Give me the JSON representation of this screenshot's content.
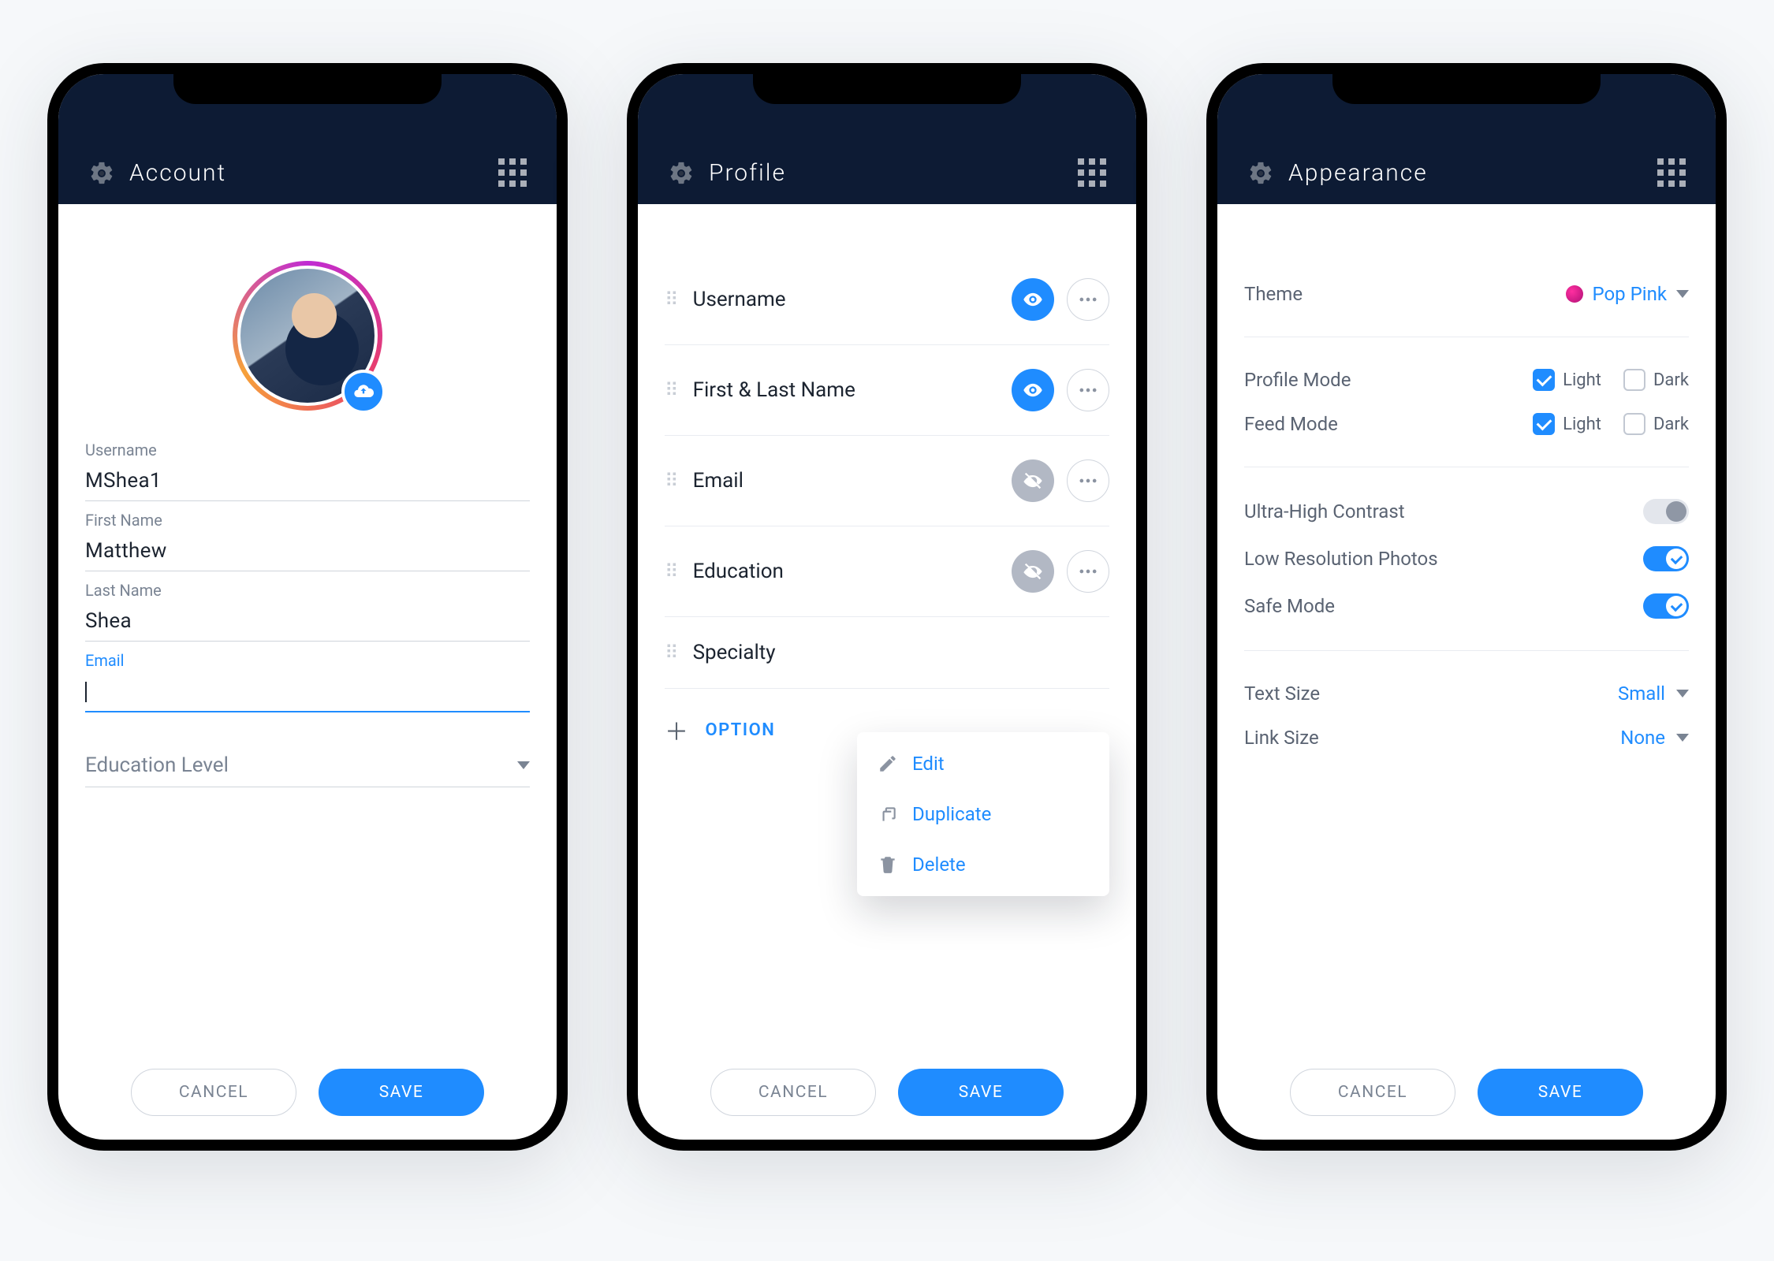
{
  "common": {
    "cancel": "CANCEL",
    "save": "SAVE"
  },
  "account": {
    "title": "Account",
    "fields": {
      "username_label": "Username",
      "username_value": "MShea1",
      "first_name_label": "First Name",
      "first_name_value": "Matthew",
      "last_name_label": "Last Name",
      "last_name_value": "Shea",
      "email_label": "Email",
      "email_value": "",
      "education_placeholder": "Education Level"
    }
  },
  "profile": {
    "title": "Profile",
    "rows": [
      {
        "label": "Username",
        "visible": true
      },
      {
        "label": "First & Last Name",
        "visible": true
      },
      {
        "label": "Email",
        "visible": false
      },
      {
        "label": "Education",
        "visible": false
      },
      {
        "label": "Specialty",
        "visible": true
      }
    ],
    "add_label": "OPTION",
    "menu": {
      "edit": "Edit",
      "duplicate": "Duplicate",
      "delete": "Delete"
    }
  },
  "appearance": {
    "title": "Appearance",
    "theme_label": "Theme",
    "theme_value": "Pop Pink",
    "modes": [
      {
        "label": "Profile Mode",
        "light": true,
        "dark": false
      },
      {
        "label": "Feed Mode",
        "light": true,
        "dark": false
      }
    ],
    "light_label": "Light",
    "dark_label": "Dark",
    "toggles": [
      {
        "label": "Ultra-High Contrast",
        "on": false
      },
      {
        "label": "Low Resolution Photos",
        "on": true
      },
      {
        "label": "Safe Mode",
        "on": true
      }
    ],
    "text_size_label": "Text Size",
    "text_size_value": "Small",
    "link_size_label": "Link Size",
    "link_size_value": "None"
  }
}
